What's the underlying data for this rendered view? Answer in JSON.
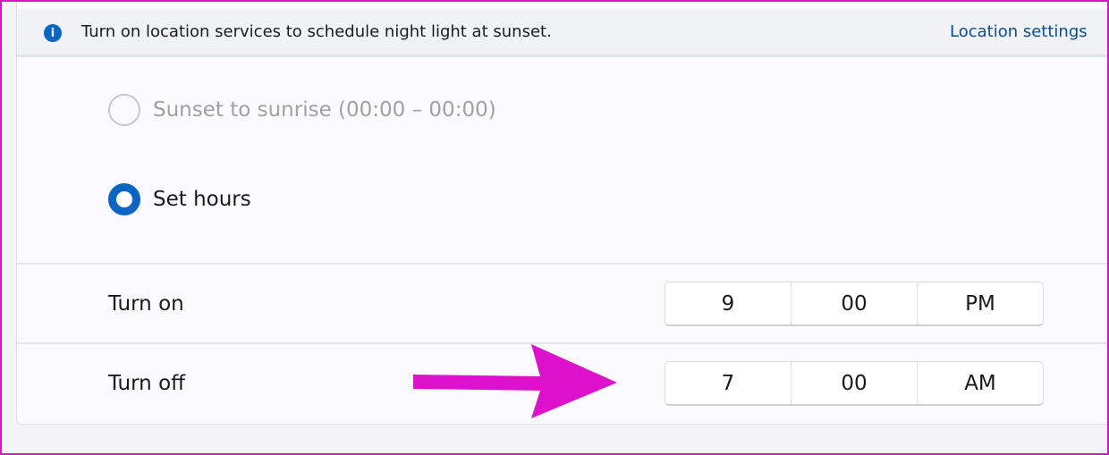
{
  "banner": {
    "icon": "info-icon",
    "message": "Turn on location services to schedule night light at sunset.",
    "link": "Location settings"
  },
  "schedule_options": [
    {
      "label": "Sunset to sunrise (00:00 – 00:00)",
      "selected": false,
      "disabled": true
    },
    {
      "label": "Set hours",
      "selected": true,
      "disabled": false
    }
  ],
  "turn_on": {
    "label": "Turn on",
    "hour": "9",
    "minute": "00",
    "period": "PM"
  },
  "turn_off": {
    "label": "Turn off",
    "hour": "7",
    "minute": "00",
    "period": "AM"
  },
  "colors": {
    "accent": "#0a66c2",
    "arrow": "#dd11cc",
    "link": "#0a4d91"
  }
}
